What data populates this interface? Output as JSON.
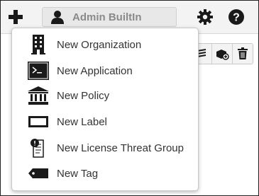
{
  "header": {
    "user_name": "Admin BuiltIn"
  },
  "menu": {
    "items": [
      {
        "label": "New Organization",
        "icon": "building-icon"
      },
      {
        "label": "New Application",
        "icon": "terminal-icon"
      },
      {
        "label": "New Policy",
        "icon": "courthouse-icon"
      },
      {
        "label": "New Label",
        "icon": "label-icon"
      },
      {
        "label": "New License Threat Group",
        "icon": "license-threat-icon"
      },
      {
        "label": "New Tag",
        "icon": "tag-icon"
      }
    ]
  },
  "toolbar": {
    "buttons": [
      "sort-icon",
      "add-component-icon",
      "trash-icon"
    ]
  },
  "colors": {
    "menu_text": "#333333",
    "user_text": "#8a8a8a",
    "icon": "#1a1a1a"
  }
}
